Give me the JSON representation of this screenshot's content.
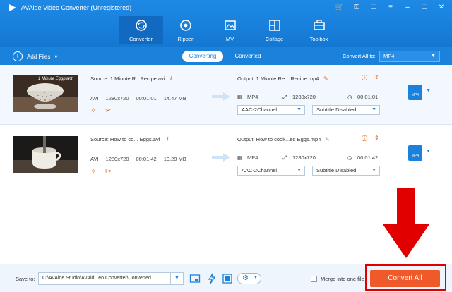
{
  "window": {
    "title": "AVAide Video Converter (Unregistered)"
  },
  "nav": [
    {
      "label": "Converter",
      "icon": "converter-icon"
    },
    {
      "label": "Ripper",
      "icon": "disc-icon"
    },
    {
      "label": "MV",
      "icon": "mv-icon"
    },
    {
      "label": "Collage",
      "icon": "collage-icon"
    },
    {
      "label": "Toolbox",
      "icon": "toolbox-icon"
    }
  ],
  "toolbar": {
    "add_files": "Add Files",
    "tab_converting": "Converting",
    "tab_converted": "Converted",
    "convert_all_to": "Convert All to:",
    "format": "MP4"
  },
  "files": [
    {
      "source": "Source: 1 Minute R...Recipe.avi",
      "src_format": "AVI",
      "src_res": "1280x720",
      "src_dur": "00:01:01",
      "src_size": "14.47 MB",
      "output": "Output: 1 Minute Re... Recipe.mp4",
      "out_format": "MP4",
      "out_res": "1280x720",
      "out_dur": "00:01:01",
      "audio": "AAC-2Channel",
      "subtitle": "Subtitle Disabled",
      "thumb_text": "1 Minute Eggplant"
    },
    {
      "source": "Source: How to co... Eggs.avi",
      "src_format": "AVI",
      "src_res": "1280x720",
      "src_dur": "00:01:42",
      "src_size": "10.20 MB",
      "output": "Output: How to cook...ed Eggs.mp4",
      "out_format": "MP4",
      "out_res": "1280x720",
      "out_dur": "00:01:42",
      "audio": "AAC-2Channel",
      "subtitle": "Subtitle Disabled",
      "thumb_text": ""
    }
  ],
  "format_badge": "MP4",
  "bottom": {
    "save_to": "Save to:",
    "path": "C:\\AVAide Studio\\AVAid...eo Converter\\Converted",
    "merge": "Merge into one file",
    "convert_all": "Convert All"
  },
  "colors": {
    "header": "#1b82dc",
    "accent_orange": "#f05a2a",
    "annotation_red": "#e00000"
  }
}
